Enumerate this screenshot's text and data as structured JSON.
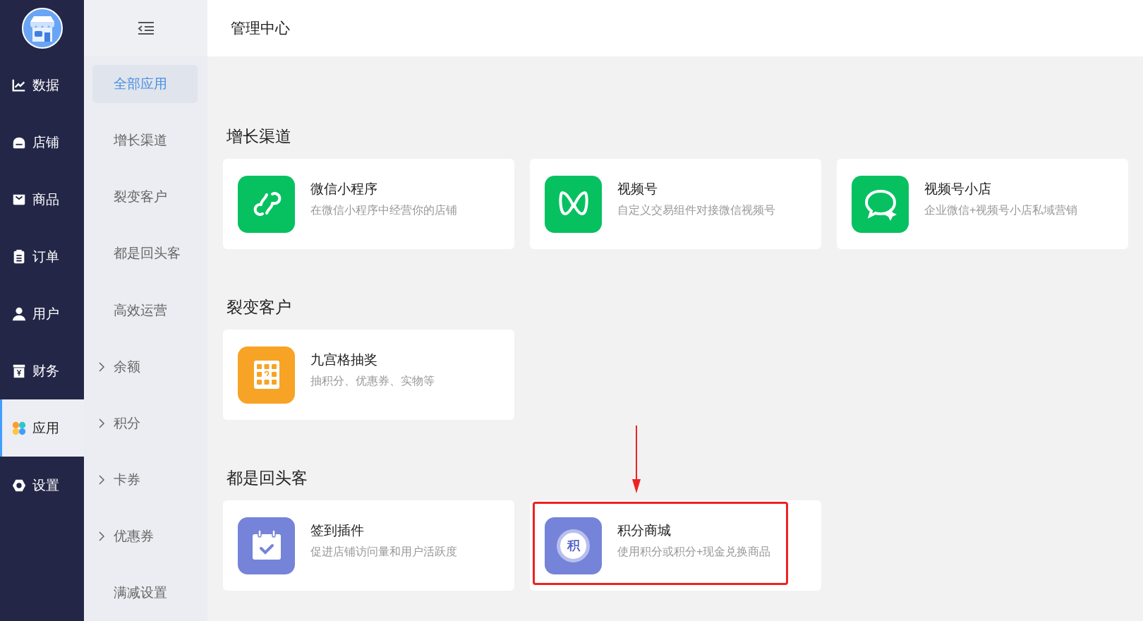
{
  "header": {
    "title": "管理中心"
  },
  "main_nav": [
    {
      "kind": "chart",
      "label": "数据",
      "selected": false
    },
    {
      "kind": "store",
      "label": "店铺",
      "selected": false
    },
    {
      "kind": "bag",
      "label": "商品",
      "selected": false
    },
    {
      "kind": "clipboard",
      "label": "订单",
      "selected": false
    },
    {
      "kind": "user",
      "label": "用户",
      "selected": false
    },
    {
      "kind": "finance",
      "label": "财务",
      "selected": false
    },
    {
      "kind": "apps",
      "label": "应用",
      "selected": true
    },
    {
      "kind": "gear",
      "label": "设置",
      "selected": false
    }
  ],
  "sub_nav": [
    {
      "label": "全部应用",
      "selected": true,
      "expandable": false
    },
    {
      "label": "增长渠道",
      "selected": false,
      "expandable": false
    },
    {
      "label": "裂变客户",
      "selected": false,
      "expandable": false
    },
    {
      "label": "都是回头客",
      "selected": false,
      "expandable": false
    },
    {
      "label": "高效运营",
      "selected": false,
      "expandable": false
    },
    {
      "label": "余额",
      "selected": false,
      "expandable": true
    },
    {
      "label": "积分",
      "selected": false,
      "expandable": true
    },
    {
      "label": "卡券",
      "selected": false,
      "expandable": true
    },
    {
      "label": "优惠券",
      "selected": false,
      "expandable": true
    },
    {
      "label": "满减设置",
      "selected": false,
      "expandable": false
    }
  ],
  "sections": [
    {
      "title": "增长渠道",
      "apps": [
        {
          "kind": "miniprogram",
          "color": "#07c160",
          "name": "微信小程序",
          "description": "在微信小程序中经营你的店铺",
          "highlighted": false
        },
        {
          "kind": "channels",
          "color": "#07c160",
          "name": "视频号",
          "description": "自定义交易组件对接微信视频号",
          "highlighted": false
        },
        {
          "kind": "chat",
          "color": "#07c160",
          "name": "视频号小店",
          "description": "企业微信+视频号小店私域营销",
          "highlighted": false
        }
      ]
    },
    {
      "title": "裂变客户",
      "apps": [
        {
          "kind": "grid",
          "color": "#f7a325",
          "name": "九宫格抽奖",
          "description": "抽积分、优惠券、实物等",
          "highlighted": false
        }
      ]
    },
    {
      "title": "都是回头客",
      "apps": [
        {
          "kind": "calendar",
          "color": "#7583d9",
          "name": "签到插件",
          "description": "促进店铺访问量和用户活跃度",
          "highlighted": false
        },
        {
          "kind": "points",
          "color": "#7583d9",
          "name": "积分商城",
          "description": "使用积分或积分+现金兑换商品",
          "highlighted": true,
          "badge_text": "积"
        }
      ]
    }
  ]
}
